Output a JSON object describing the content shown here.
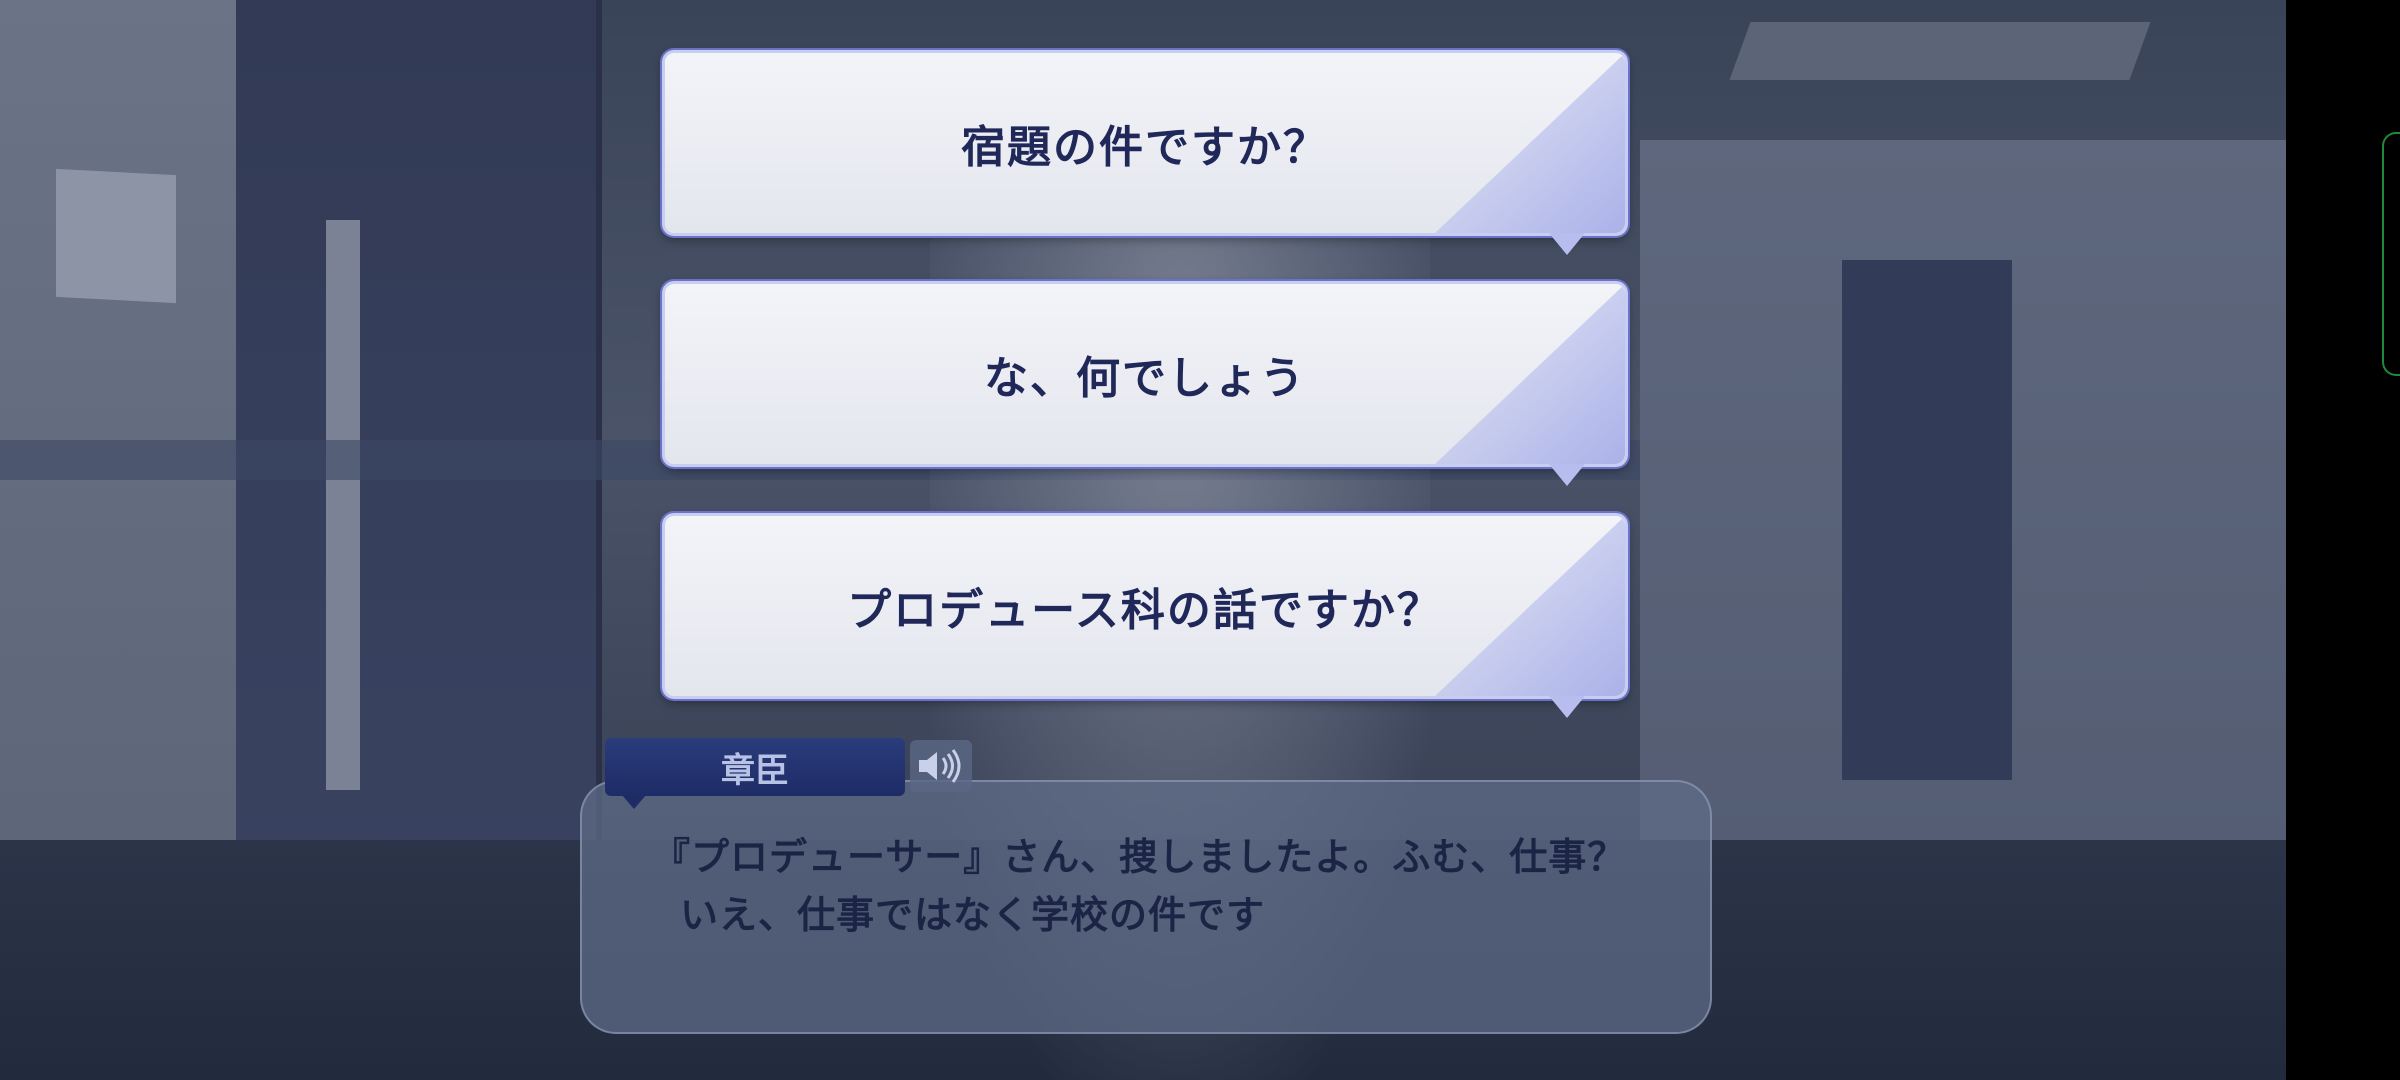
{
  "choices": [
    {
      "label": "宿題の件ですか？"
    },
    {
      "label": "な、何でしょう"
    },
    {
      "label": "プロデュース科の話ですか？"
    }
  ],
  "dialog": {
    "speaker": "章臣",
    "line1": "『プロデューサー』さん、捜しましたよ。ふむ、仕事？",
    "line2": "いえ、仕事ではなく学校の件です"
  },
  "icons": {
    "voice": "speaker-icon",
    "side_handle": "side-panel-handle-icon"
  },
  "colors": {
    "choice_text": "#20285a",
    "choice_border": "#6b72c9",
    "name_tag": "#1e2c66",
    "dialog_text": "#1c2446"
  }
}
